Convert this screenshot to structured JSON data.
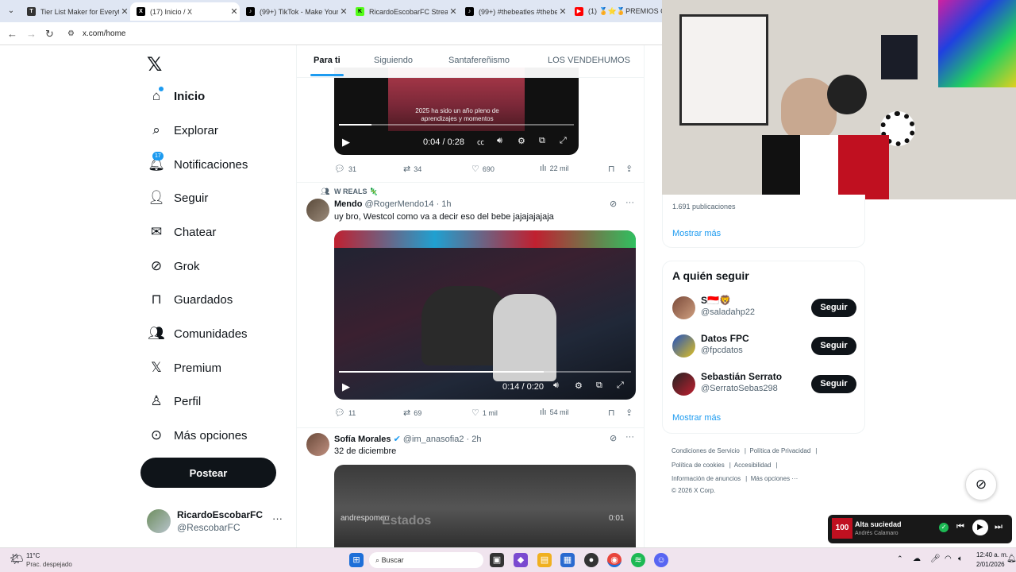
{
  "browser": {
    "tabs": [
      {
        "title": "Tier List Maker for Everythi",
        "icon": "tiermaker-icon",
        "color": "#333"
      },
      {
        "title": "(17) Inicio / X",
        "icon": "x-icon",
        "color": "#000"
      },
      {
        "title": "(99+) TikTok - Make Your D",
        "icon": "tiktok-icon",
        "color": "#000"
      },
      {
        "title": "RicardoEscobarFC Stream",
        "icon": "kick-icon",
        "color": "#53fc18"
      },
      {
        "title": "(99+) #thebeatles #thebeat",
        "icon": "tiktok-icon",
        "color": "#000"
      },
      {
        "title": "(1) 🏅⭐🏅PREMIOS CA",
        "icon": "youtube-icon",
        "color": "#ff0000"
      }
    ],
    "url": "x.com/home"
  },
  "sidebar": {
    "items": [
      {
        "label": "Inicio",
        "icon": "home-icon"
      },
      {
        "label": "Explorar",
        "icon": "search-icon"
      },
      {
        "label": "Notificaciones",
        "icon": "bell-icon",
        "badge": "17"
      },
      {
        "label": "Seguir",
        "icon": "follow-icon"
      },
      {
        "label": "Chatear",
        "icon": "mail-icon"
      },
      {
        "label": "Grok",
        "icon": "grok-icon"
      },
      {
        "label": "Guardados",
        "icon": "bookmark-icon"
      },
      {
        "label": "Comunidades",
        "icon": "communities-icon"
      },
      {
        "label": "Premium",
        "icon": "x-premium-icon"
      },
      {
        "label": "Perfil",
        "icon": "person-icon"
      },
      {
        "label": "Más opciones",
        "icon": "more-circle-icon"
      }
    ],
    "post_label": "Postear",
    "account": {
      "name": "RicardoEscobarFC",
      "handle": "@RescobarFC",
      "more": "···"
    }
  },
  "feed": {
    "tabs": [
      "Para ti",
      "Siguiendo",
      "Santafereñismo",
      "LOS VENDEHUMOS"
    ],
    "tweet0": {
      "caption": "2025 ha sido un año pleno de aprendizajes y momentos",
      "time": "0:04 / 0:28",
      "progress": 0.14,
      "replies": "31",
      "reposts": "34",
      "likes": "690",
      "views": "22 mil"
    },
    "tweet1": {
      "context": "W REALS 🦎",
      "name": "Mendo",
      "handle": "@RogerMendo14 · 1h",
      "text": "uy bro, Westcol como va a decir eso del bebe jajajajajaja",
      "time": "0:14 / 0:20",
      "progress": 0.7,
      "replies": "11",
      "reposts": "69",
      "likes": "1 mil",
      "views": "54 mil"
    },
    "tweet2": {
      "name": "Sofía Morales",
      "handle": "@im_anasofia2 · 2h",
      "text": "32 de diciembre",
      "overlay_user": "andrespomeo",
      "overlay_time": "0:01",
      "overlay_text": "Estados"
    }
  },
  "right": {
    "posts_count": "1.691 publicaciones",
    "show_more": "Mostrar más",
    "who_to_follow": "A quién seguir",
    "follow": [
      {
        "name": "S🇮🇩🦁",
        "handle": "@saladahp22",
        "button": "Seguir"
      },
      {
        "name": "Datos FPC",
        "handle": "@fpcdatos",
        "button": "Seguir"
      },
      {
        "name": "Sebastián Serrato",
        "handle": "@SerratoSebas298",
        "button": "Seguir"
      }
    ],
    "show_more2": "Mostrar más",
    "footer": [
      "Condiciones de Servicio",
      "Política de Privacidad",
      "Política de cookies",
      "Accesibilidad",
      "Información de anuncios",
      "Más opciones ···",
      "© 2026 X Corp."
    ]
  },
  "music": {
    "title": "Alta suciedad",
    "artist": "Andrés Calamaro",
    "cover_text": "100"
  },
  "taskbar": {
    "weather_temp": "11°C",
    "weather_desc": "Prac. despejado",
    "search_placeholder": "Buscar",
    "time": "12:40 a. m.",
    "date": "2/01/2026"
  }
}
